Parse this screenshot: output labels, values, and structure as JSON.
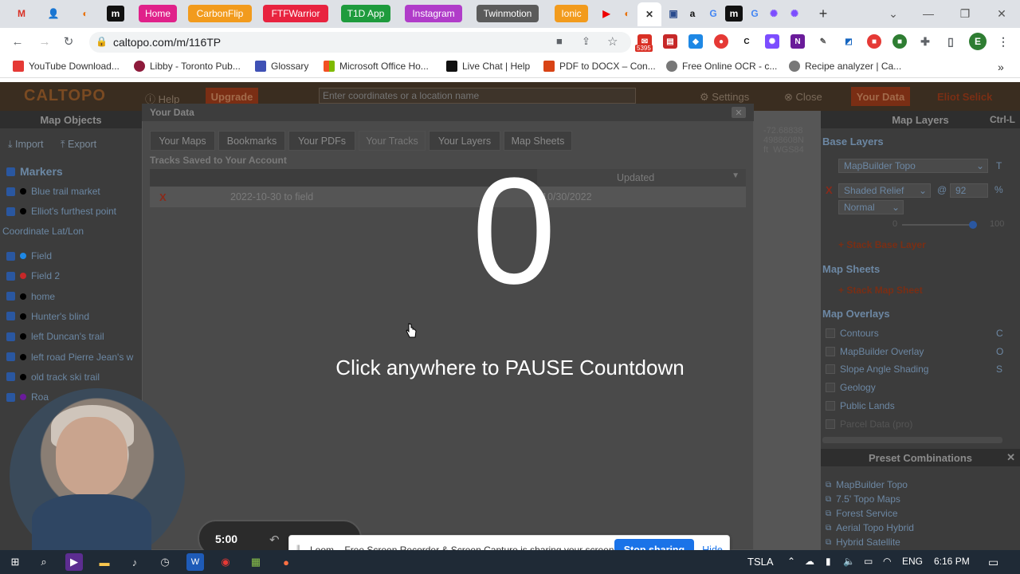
{
  "browser": {
    "url": "caltopo.com/m/116TP",
    "tabs": [
      {
        "label": "Home",
        "color": "#e0218a"
      },
      {
        "label": "CarbonFlip",
        "color": "#f29b1d"
      },
      {
        "label": "FTFWarrior",
        "color": "#e8233f"
      },
      {
        "label": "T1D App",
        "color": "#1e9b3d"
      },
      {
        "label": "Instagram",
        "color": "#b03cc9"
      },
      {
        "label": "Twinmotion",
        "color": "#5b5b5b"
      },
      {
        "label": "Ionic",
        "color": "#f29b1d"
      }
    ],
    "badge_count": "5395",
    "bookmarks": [
      {
        "label": "YouTube Download...",
        "icon_color": "#e53935"
      },
      {
        "label": "Libby - Toronto Pub...",
        "icon_color": "#8e1b3b"
      },
      {
        "label": "Glossary",
        "icon_color": "#3f51b5"
      },
      {
        "label": "Microsoft Office Ho...",
        "icon_color": "#f25022"
      },
      {
        "label": "Live Chat | Help",
        "icon_color": "#111111"
      },
      {
        "label": "PDF to DOCX – Con...",
        "icon_color": "#d84315"
      },
      {
        "label": "Free Online OCR - c...",
        "icon_color": "#777777"
      },
      {
        "label": "Recipe analyzer | Ca...",
        "icon_color": "#777777"
      }
    ]
  },
  "app": {
    "logo": "CALTOPO",
    "help": "Help",
    "upgrade": "Upgrade",
    "search_placeholder": "Enter coordinates or a location name",
    "settings": "Settings",
    "close": "Close",
    "your_data": "Your Data",
    "user": "Eliot Selick",
    "left_panel": {
      "header": "Map Objects",
      "import": "Import",
      "export": "Export",
      "markers_heading": "Markers",
      "coord_label": "Coordinate Lat/Lon",
      "markers_a": [
        {
          "label": "Blue trail market",
          "color": "#000000"
        },
        {
          "label": "Elliot's furthest point",
          "color": "#000000"
        }
      ],
      "markers_b": [
        {
          "label": "Field",
          "color": "#1e88e5"
        },
        {
          "label": "Field 2",
          "color": "#c62828"
        },
        {
          "label": "home",
          "color": "#000000"
        },
        {
          "label": "Hunter's blind",
          "color": "#000000"
        },
        {
          "label": "left Duncan's trail",
          "color": "#000000"
        },
        {
          "label": "left road Pierre Jean's w",
          "color": "#000000"
        },
        {
          "label": "old track ski trail",
          "color": "#000000"
        },
        {
          "label": "Roa",
          "color": "#6a1b9a"
        }
      ]
    },
    "map_readout": {
      "lon": "-72.68838",
      "northing": "4988608N",
      "datum": "WGS84",
      "unit": "ft"
    },
    "right_panel": {
      "header": "Map Layers",
      "shortcut": "Ctrl-L",
      "base_layers": "Base Layers",
      "base_select": "MapBuilder Topo",
      "base_key": "T",
      "shaded": "Shaded Relief",
      "opacity": "92",
      "percent": "%",
      "blend": "Normal",
      "range_min": "0",
      "range_max": "100",
      "stack_base": "+ Stack Base Layer",
      "map_sheets": "Map Sheets",
      "stack_sheet": "+ Stack Map Sheet",
      "overlays_heading": "Map Overlays",
      "overlays": [
        {
          "label": "Contours",
          "key": "C"
        },
        {
          "label": "MapBuilder Overlay",
          "key": "O"
        },
        {
          "label": "Slope Angle Shading",
          "key": "S"
        },
        {
          "label": "Geology",
          "key": ""
        },
        {
          "label": "Public Lands",
          "key": ""
        },
        {
          "label": "Parcel Data (pro)",
          "key": ""
        }
      ],
      "preset_header": "Preset Combinations",
      "presets": [
        "MapBuilder Topo",
        "7.5' Topo Maps",
        "Forest Service",
        "Aerial Topo Hybrid",
        "Hybrid Satellite"
      ]
    },
    "dialog": {
      "title": "Your Data",
      "tabs": [
        "Your Maps",
        "Bookmarks",
        "Your PDFs",
        "Your Tracks",
        "Your Layers",
        "Map Sheets"
      ],
      "active_tab": "Your Tracks",
      "section": "Tracks Saved to Your Account",
      "col_updated": "Updated",
      "row_delete": "X",
      "row_name": "2022-10-30 to field",
      "row_date": "10/30/2022"
    }
  },
  "overlay": {
    "countdown": "0",
    "message": "Click anywhere to PAUSE Countdown"
  },
  "loom": {
    "timer": "5:00",
    "share_message": "Loom – Free Screen Recorder & Screen Capture is sharing your screen.",
    "stop_label": "Stop sharing",
    "hide_label": "Hide"
  },
  "taskbar": {
    "ticker": "TSLA",
    "lang": "ENG",
    "time": "6:16 PM"
  }
}
